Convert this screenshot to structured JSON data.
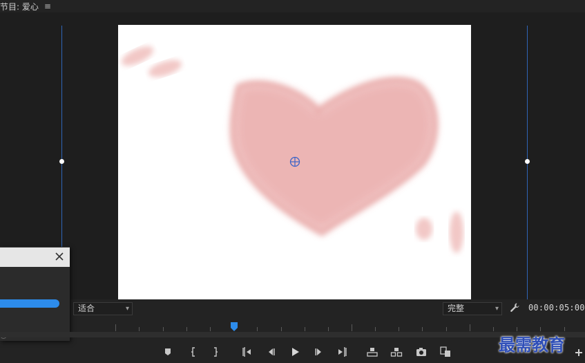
{
  "panel": {
    "title": "节目: 爱心",
    "menu_icon": "hamburger-icon"
  },
  "canvas": {
    "background": "#ffffff",
    "heart_color": "#e9a9a8",
    "anchor_icon": "crosshair-icon"
  },
  "dialog": {
    "close_icon": "close-icon",
    "progress_color": "#2d8ceb"
  },
  "controls": {
    "fit_select": {
      "value": "适合"
    },
    "quality_select": {
      "value": "完整"
    },
    "settings_icon": "wrench-icon",
    "timecode": "00:00:05:00"
  },
  "timeline": {
    "playhead_icon": "playhead-icon"
  },
  "transport": {
    "buttons": [
      "add-marker-icon",
      "mark-in-icon",
      "mark-out-icon",
      "go-to-in-icon",
      "step-back-icon",
      "play-icon",
      "step-forward-icon",
      "go-to-out-icon",
      "lift-icon",
      "extract-icon",
      "export-frame-icon",
      "compare-view-icon"
    ]
  },
  "watermark": {
    "text": "最需教育"
  },
  "colors": {
    "accent": "#2f66b8",
    "background": "#232323"
  }
}
